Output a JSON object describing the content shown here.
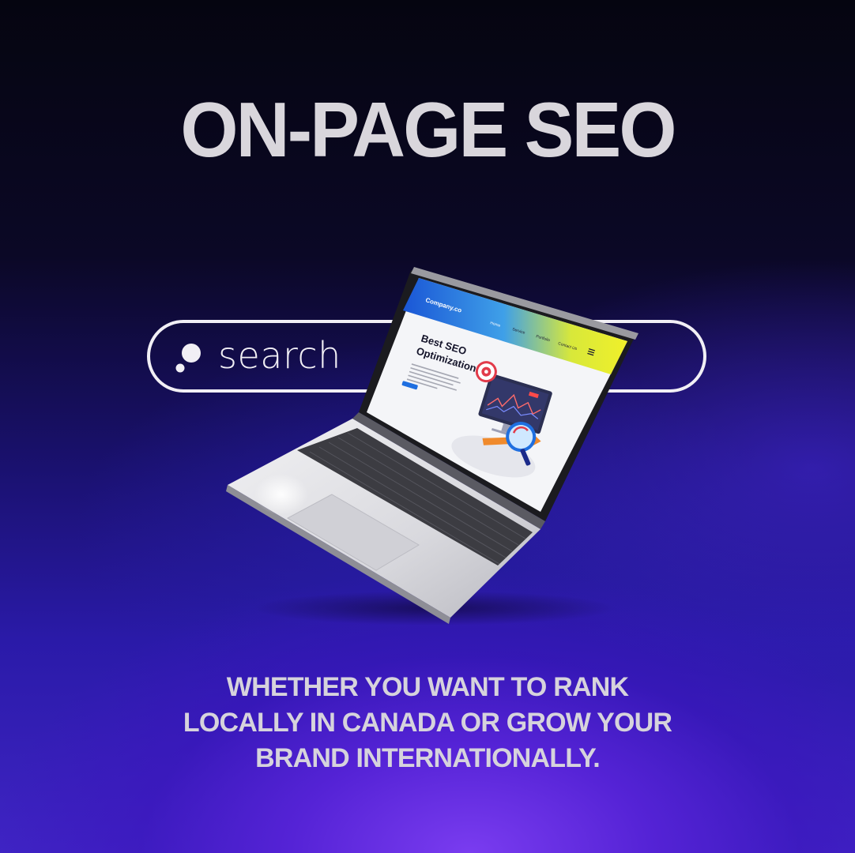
{
  "headline": "ON-PAGE SEO",
  "search": {
    "text": "search",
    "icon": "search-dots-icon"
  },
  "laptop_screen": {
    "brand": "Company.co",
    "nav": [
      "Home",
      "Service",
      "Portfolio",
      "Contact Us"
    ],
    "hero_title_line1": "Best SEO",
    "hero_title_line2": "Optimization"
  },
  "tagline": {
    "line1": "WHETHER YOU WANT TO RANK",
    "line2": "LOCALLY IN CANADA OR GROW YOUR",
    "line3": "BRAND INTERNATIONALLY."
  },
  "colors": {
    "background_top": "#050510",
    "background_bottom": "#3f24c4",
    "glow": "#7a3cf0",
    "text": "#d9d6dc"
  }
}
